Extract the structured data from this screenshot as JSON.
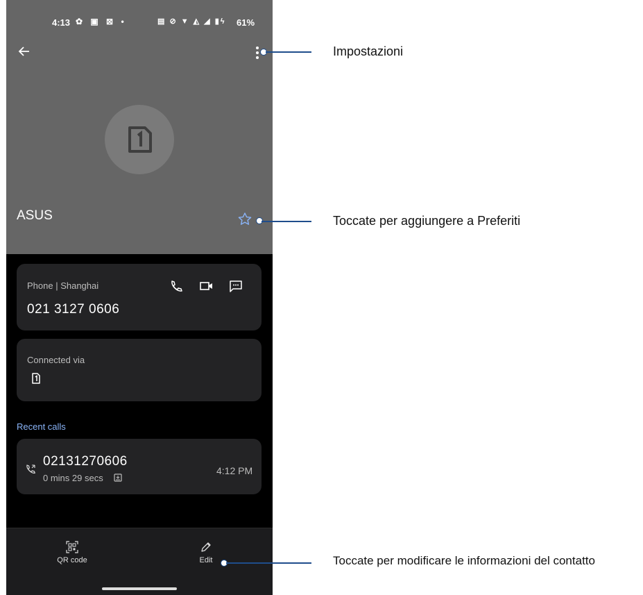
{
  "status_bar": {
    "time": "4:13",
    "battery": "61%"
  },
  "contact": {
    "name": "ASUS"
  },
  "phone_card": {
    "label": "Phone | Shanghai",
    "number": "021 3127 0606"
  },
  "connected_card": {
    "label": "Connected via"
  },
  "recent_calls": {
    "title": "Recent calls",
    "items": [
      {
        "number": "02131270606",
        "duration": "0 mins 29 secs",
        "time": "4:12 PM"
      }
    ]
  },
  "bottom_bar": {
    "qr_label": "QR code",
    "edit_label": "Edit"
  },
  "callouts": {
    "settings": "Impostazioni",
    "favorite": "Toccate per aggiungere a Preferiti",
    "edit": "Toccate per modificare le informazioni del contatto"
  },
  "colors": {
    "header_bg": "#666666",
    "card_bg": "#232325",
    "accent_link": "#8ab4f8",
    "callout_line": "#1f4d8c"
  }
}
